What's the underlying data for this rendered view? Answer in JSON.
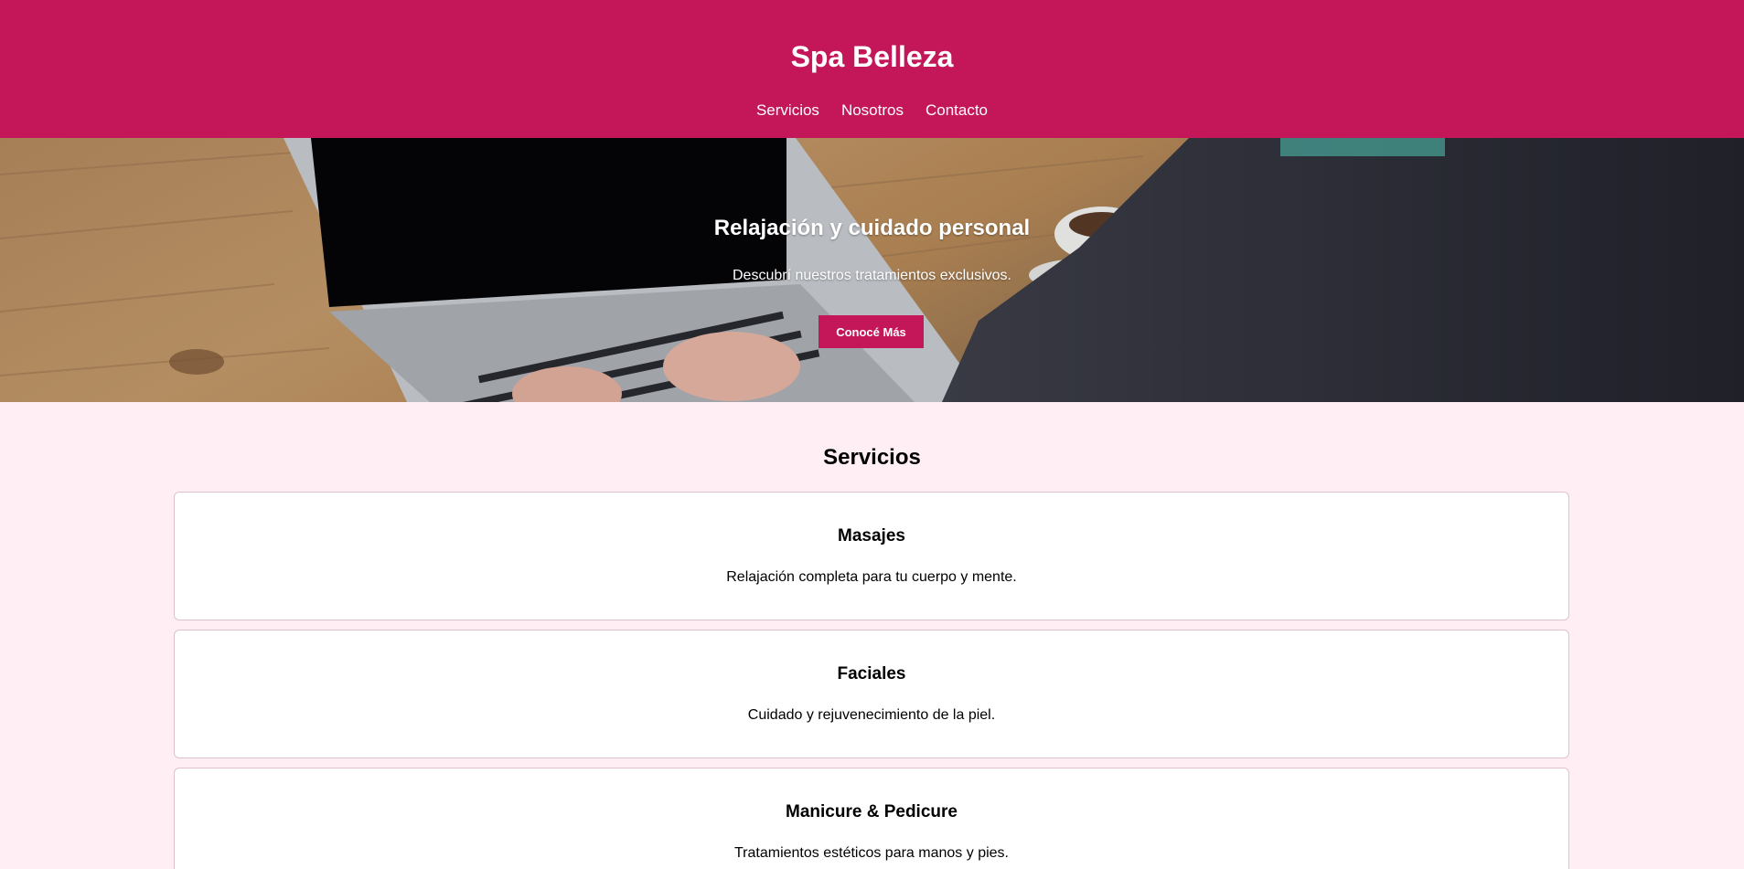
{
  "header": {
    "title": "Spa Belleza",
    "nav": [
      "Servicios",
      "Nosotros",
      "Contacto"
    ],
    "background_color": "#c4175a"
  },
  "hero": {
    "title": "Relajación y cuidado personal",
    "subtitle": "Descubrí nuestros tratamientos exclusivos.",
    "button_label": "Conocé Más"
  },
  "services": {
    "title": "Servicios",
    "items": [
      {
        "name": "Masajes",
        "description": "Relajación completa para tu cuerpo y mente."
      },
      {
        "name": "Faciales",
        "description": "Cuidado y rejuvenecimiento de la piel."
      },
      {
        "name": "Manicure & Pedicure",
        "description": "Tratamientos estéticos para manos y pies."
      }
    ]
  },
  "colors": {
    "accent": "#c4175a",
    "page_background": "#ffeef4",
    "card_background": "#ffffff"
  }
}
